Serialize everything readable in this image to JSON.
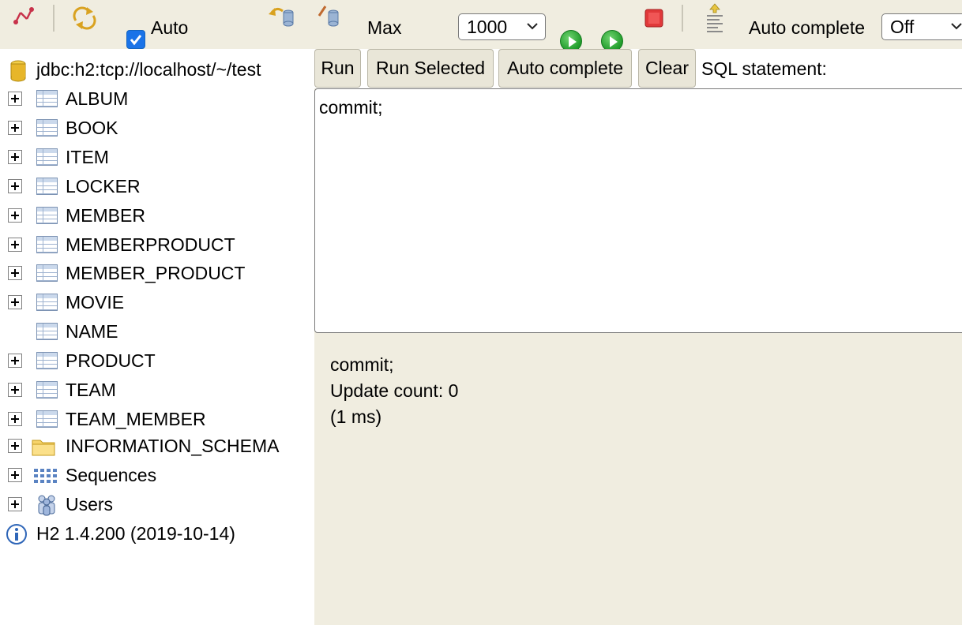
{
  "toolbar": {
    "disconnect_icon": "disconnect-icon",
    "refresh_icon": "refresh-icon",
    "auto_commit_label": "Auto",
    "auto_commit_checked": true,
    "rollback_icon": "rollback-icon",
    "commit_icon": "commit-icon",
    "max_label": "Max",
    "max_rows": "1000",
    "run_icon": "run-icon",
    "run_selected_icon": "run-selected-icon",
    "stop_icon": "stop-icon",
    "history_icon": "history-icon",
    "auto_complete_label": "Auto complete",
    "auto_complete_value": "Off"
  },
  "tree": {
    "connection": "jdbc:h2:tcp://localhost/~/test",
    "tables": [
      {
        "name": "ALBUM",
        "expandable": true
      },
      {
        "name": "BOOK",
        "expandable": true
      },
      {
        "name": "ITEM",
        "expandable": true
      },
      {
        "name": "LOCKER",
        "expandable": true
      },
      {
        "name": "MEMBER",
        "expandable": true
      },
      {
        "name": "MEMBERPRODUCT",
        "expandable": true
      },
      {
        "name": "MEMBER_PRODUCT",
        "expandable": true
      },
      {
        "name": "MOVIE",
        "expandable": true
      },
      {
        "name": "NAME",
        "expandable": false
      },
      {
        "name": "PRODUCT",
        "expandable": true
      },
      {
        "name": "TEAM",
        "expandable": true
      },
      {
        "name": "TEAM_MEMBER",
        "expandable": true
      }
    ],
    "information_schema": "INFORMATION_SCHEMA",
    "sequences": "Sequences",
    "users": "Users",
    "version": "H2 1.4.200 (2019-10-14)"
  },
  "query": {
    "buttons": {
      "run": "Run",
      "run_selected": "Run Selected",
      "auto_complete": "Auto complete",
      "clear": "Clear"
    },
    "sql_label": "SQL statement:",
    "sql_text": "commit;"
  },
  "result": {
    "statement": "commit;",
    "update_count": "Update count: 0",
    "duration": "(1 ms)"
  }
}
